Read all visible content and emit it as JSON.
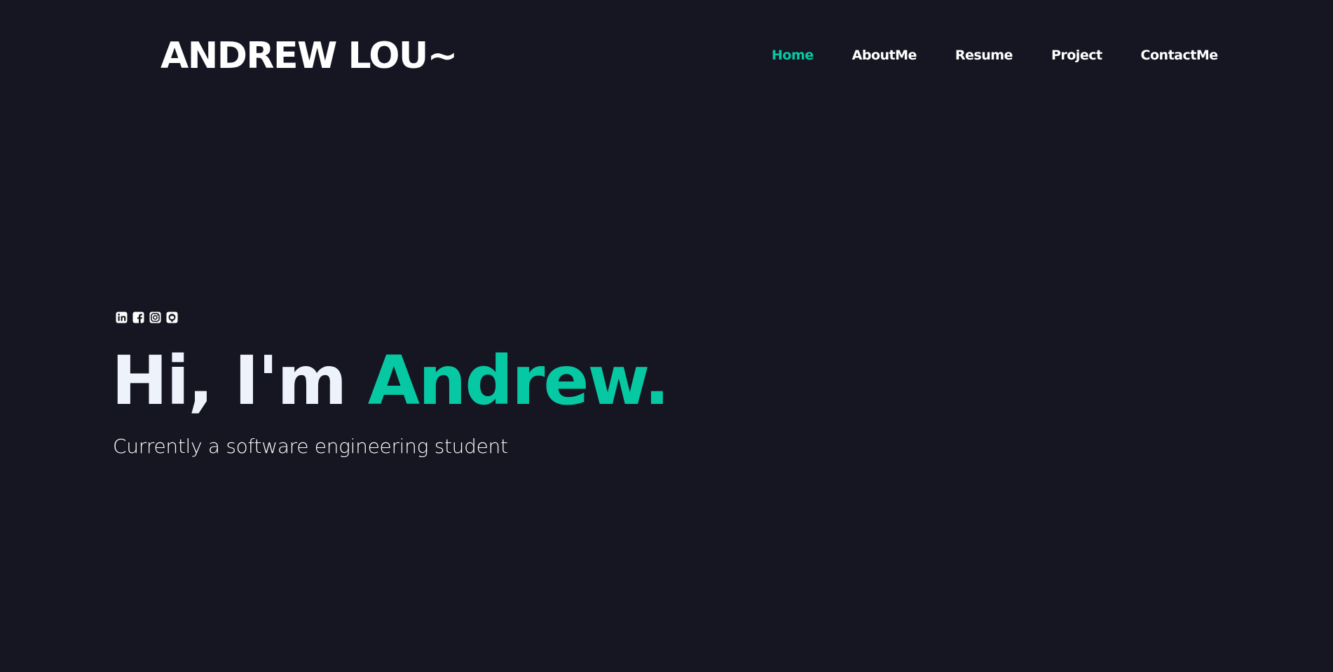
{
  "header": {
    "logo": "ANDREW LOU~",
    "nav": [
      {
        "label": "Home",
        "active": true
      },
      {
        "label": "AboutMe",
        "active": false
      },
      {
        "label": "Resume",
        "active": false
      },
      {
        "label": "Project",
        "active": false
      },
      {
        "label": "ContactMe",
        "active": false
      }
    ]
  },
  "hero": {
    "socials": [
      "linkedin-icon",
      "facebook-icon",
      "instagram-icon",
      "github-icon"
    ],
    "greeting": "Hi, I'm",
    "name": "Andrew.",
    "subtitle": "Currently a software engineering student"
  },
  "colors": {
    "background": "#161622",
    "accent": "#06c9a4",
    "text": "#ffffff",
    "heading": "#eef2fb"
  }
}
